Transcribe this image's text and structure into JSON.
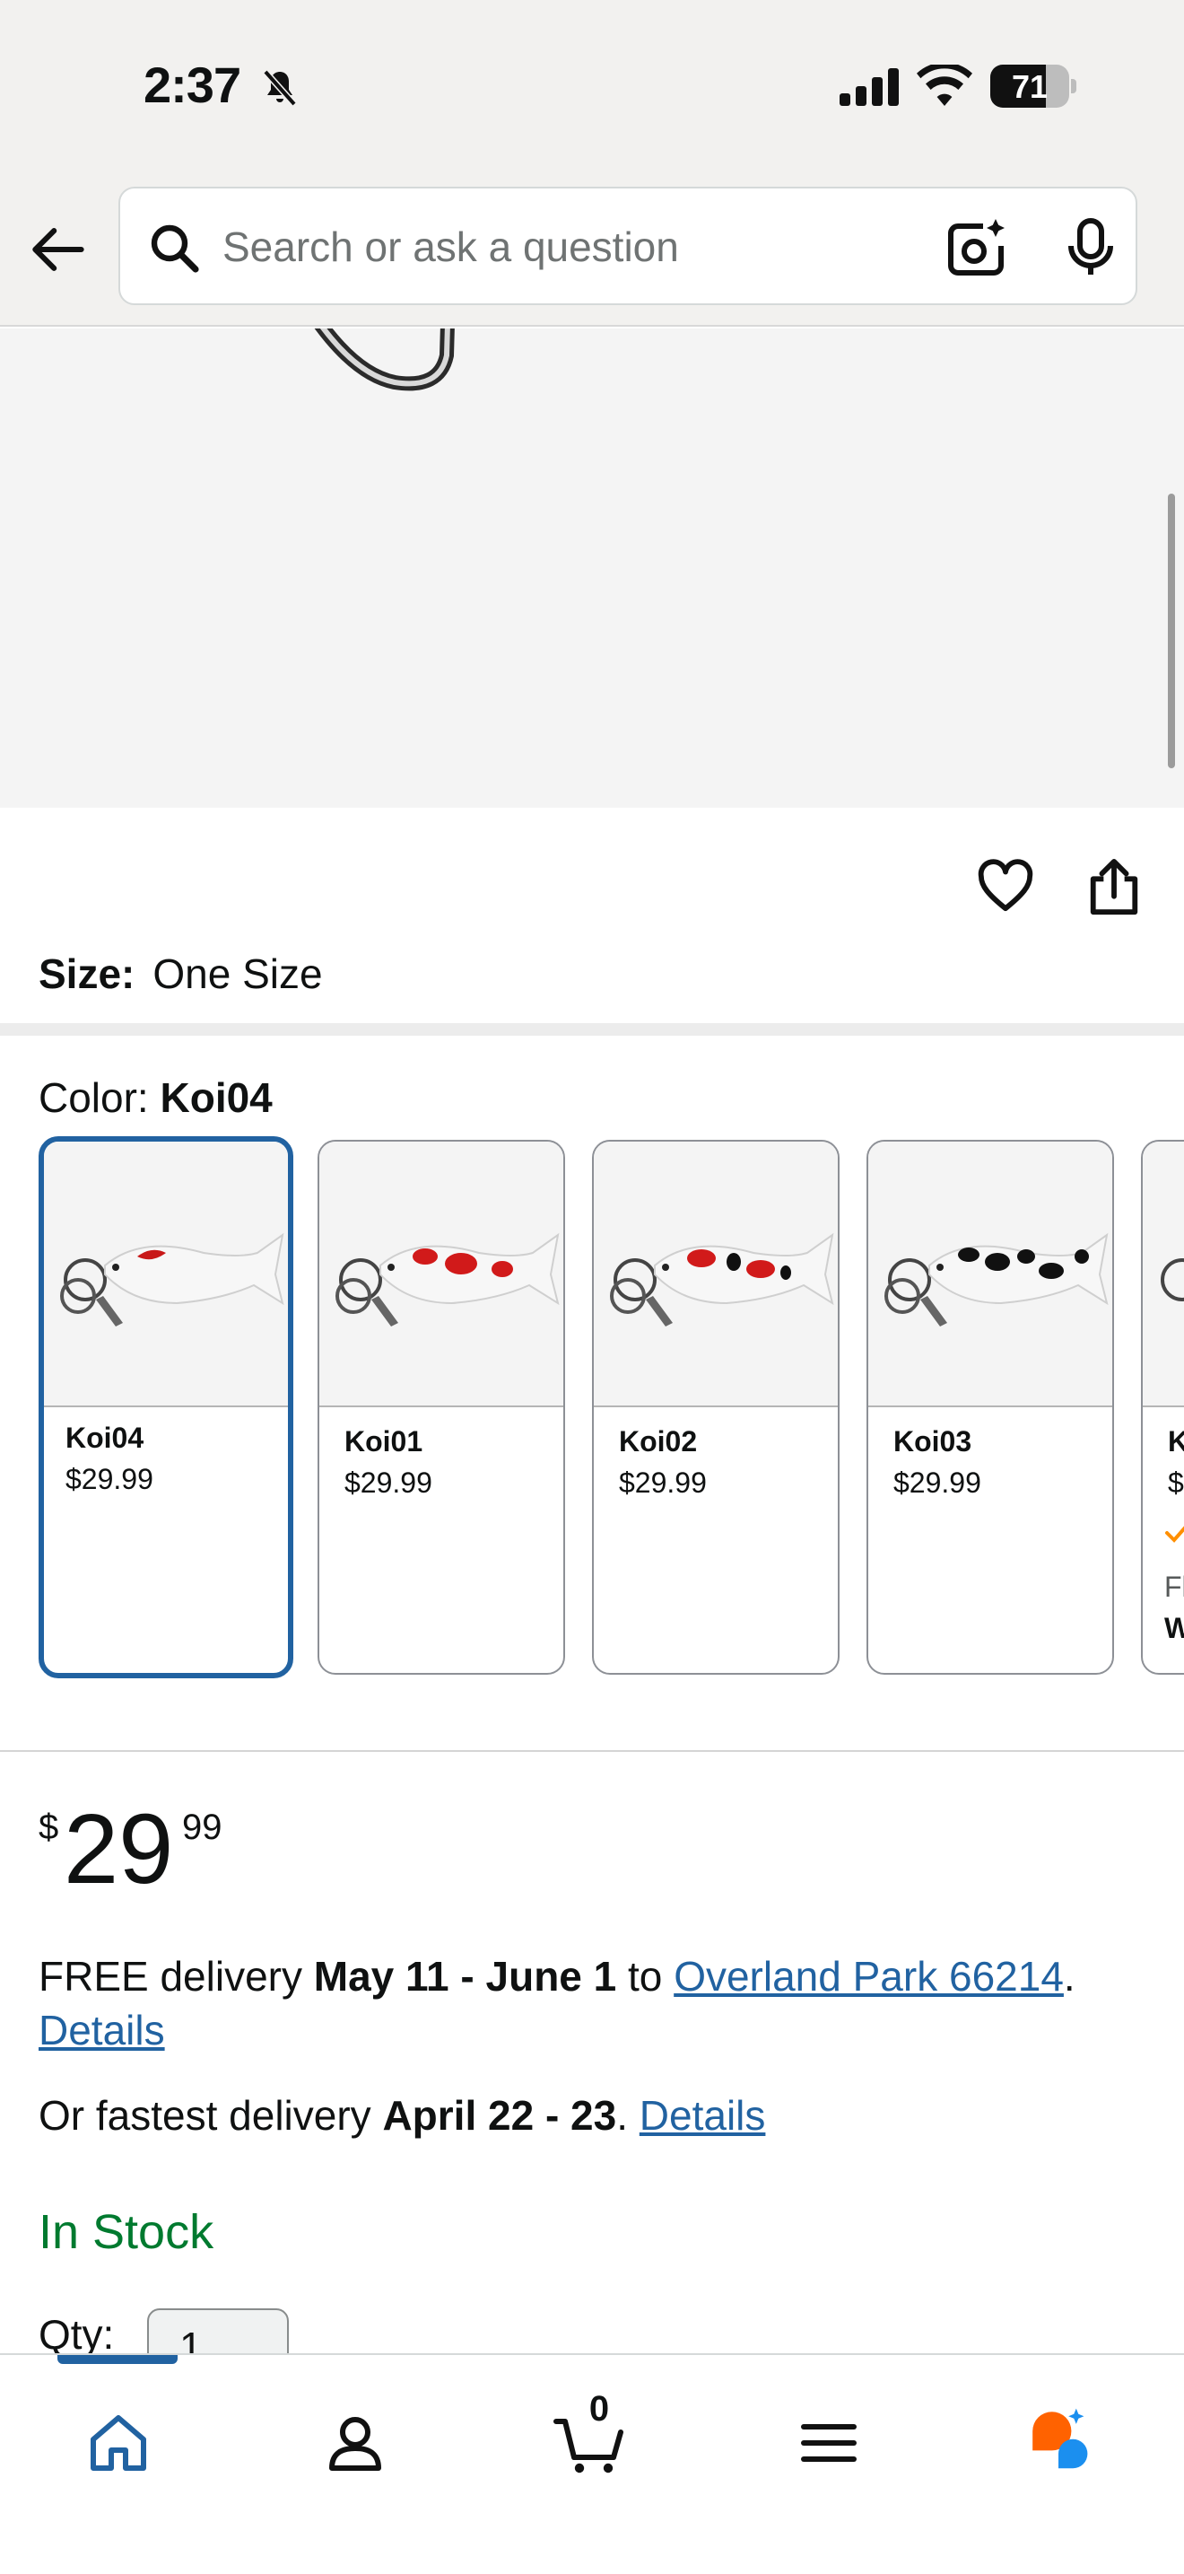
{
  "status_bar": {
    "time": "2:37",
    "battery": "71",
    "battery_level": 0.71
  },
  "search": {
    "placeholder": "Search or ask a question"
  },
  "product": {
    "size_label": "Size:",
    "size_value": "One Size",
    "color_label": "Color:",
    "color_value": "Koi04"
  },
  "swatches": [
    {
      "name": "Koi04",
      "price": "$29.99",
      "selected": true
    },
    {
      "name": "Koi01",
      "price": "$29.99",
      "selected": false
    },
    {
      "name": "Koi02",
      "price": "$29.99",
      "selected": false
    },
    {
      "name": "Koi03",
      "price": "$29.99",
      "selected": false
    },
    {
      "name": "K",
      "price": "$",
      "extra_1": "Fl",
      "extra_2": "W",
      "selected": false
    }
  ],
  "price": {
    "symbol": "$",
    "whole": "29",
    "fraction": "99"
  },
  "delivery": {
    "free_prefix": "FREE delivery ",
    "free_dates": "May 11 - June 1",
    "to": " to ",
    "location": "Overland Park 66214",
    "period": ".",
    "details_1": "Details",
    "fastest_prefix": "Or fastest delivery ",
    "fastest_dates": "April 22 - 23",
    "fastest_period": ". ",
    "details_2": "Details"
  },
  "stock": "In Stock",
  "quantity": {
    "label": "Qty:",
    "value": "1"
  },
  "cart": {
    "count": "0"
  },
  "colors": {
    "link": "#2162a1",
    "in_stock": "#007a2f",
    "selected_border": "#2162a1",
    "rufus_orange": "#ff6200",
    "rufus_blue": "#1b8fef"
  }
}
